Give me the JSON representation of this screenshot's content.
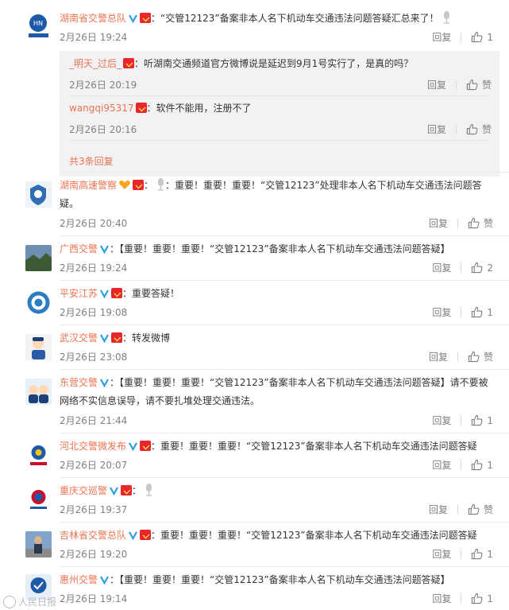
{
  "comments": [
    {
      "user": "湖南省交警总队",
      "text": "：“交管12123”备案非本人名下机动车交通违法问题答疑汇总来了！",
      "time": "2月26日 19:24",
      "reply": "回复",
      "likes": "1",
      "avatar": "blue-badge"
    },
    {
      "user": "湖南高速警察",
      "text": "：重要！重要！重要！“交管12123”处理非本人名下机动车交通违法问题答疑。",
      "time": "2月26日 20:40",
      "reply": "回复",
      "likes": "赞",
      "avatar": "police-badge"
    },
    {
      "user": "广西交警",
      "text": "：【重要！重要！重要！“交管12123”备案非本人名下机动车交通违法问题答疑】",
      "time": "2月26日 19:24",
      "reply": "回复",
      "likes": "2",
      "avatar": "landscape"
    },
    {
      "user": "平安江苏",
      "text": "：重要答疑！",
      "time": "2月26日 19:08",
      "reply": "回复",
      "likes": "1",
      "avatar": "globe"
    },
    {
      "user": "武汉交警",
      "text": "：转发微博",
      "time": "2月26日 23:08",
      "reply": "回复",
      "likes": "赞",
      "avatar": "cartoon"
    },
    {
      "user": "东营交警",
      "text": "：【重要！重要！重要！“交管12123”备案非本人名下机动车交通违法问题答疑】请不要被网络不实信息误导，请不要扎堆处理交通违法。",
      "time": "2月26日 21:44",
      "reply": "回复",
      "likes": "1",
      "avatar": "cartoon2"
    },
    {
      "user": "河北交警微发布",
      "text": "：重要！重要！重要！“交管12123”备案非本人名下机动车交通违法问题答疑",
      "time": "2月26日 20:07",
      "reply": "回复",
      "likes": "1",
      "avatar": "emblem"
    },
    {
      "user": "重庆交巡警",
      "text": "：",
      "time": "2月26日 19:37",
      "reply": "回复",
      "likes": "赞",
      "avatar": "emblem2"
    },
    {
      "user": "吉林省交警总队",
      "text": "：重要！重要！重要！“交管12123”备案非本人名下机动车交通违法问题答疑",
      "time": "2月26日 19:20",
      "reply": "回复",
      "likes": "1",
      "avatar": "officer"
    },
    {
      "user": "惠州交警",
      "text": "：【重要！重要！重要！“交管12123”备案非本人名下机动车交通违法问题答疑】",
      "time": "2月26日 19:14",
      "reply": "回复",
      "likes": "1",
      "avatar": "blue-badge2"
    }
  ],
  "sub_replies": [
    {
      "user": "_明天_过后_",
      "text": "：听湖南交通频道官方微博说是延迟到9月1号实行了，是真的吗？",
      "time": "2月26日 20:19",
      "reply": "回复",
      "likes": "赞"
    },
    {
      "user": "wangqi95317",
      "text": "：软件不能用，注册不了",
      "time": "2月26日 20:16",
      "reply": "回复",
      "likes": "赞"
    }
  ],
  "more_replies": "共3条回复",
  "watermark": "人民日报",
  "colors": {
    "username": "#eb7350",
    "verified": "#2d9ee0",
    "meta": "#808080"
  }
}
